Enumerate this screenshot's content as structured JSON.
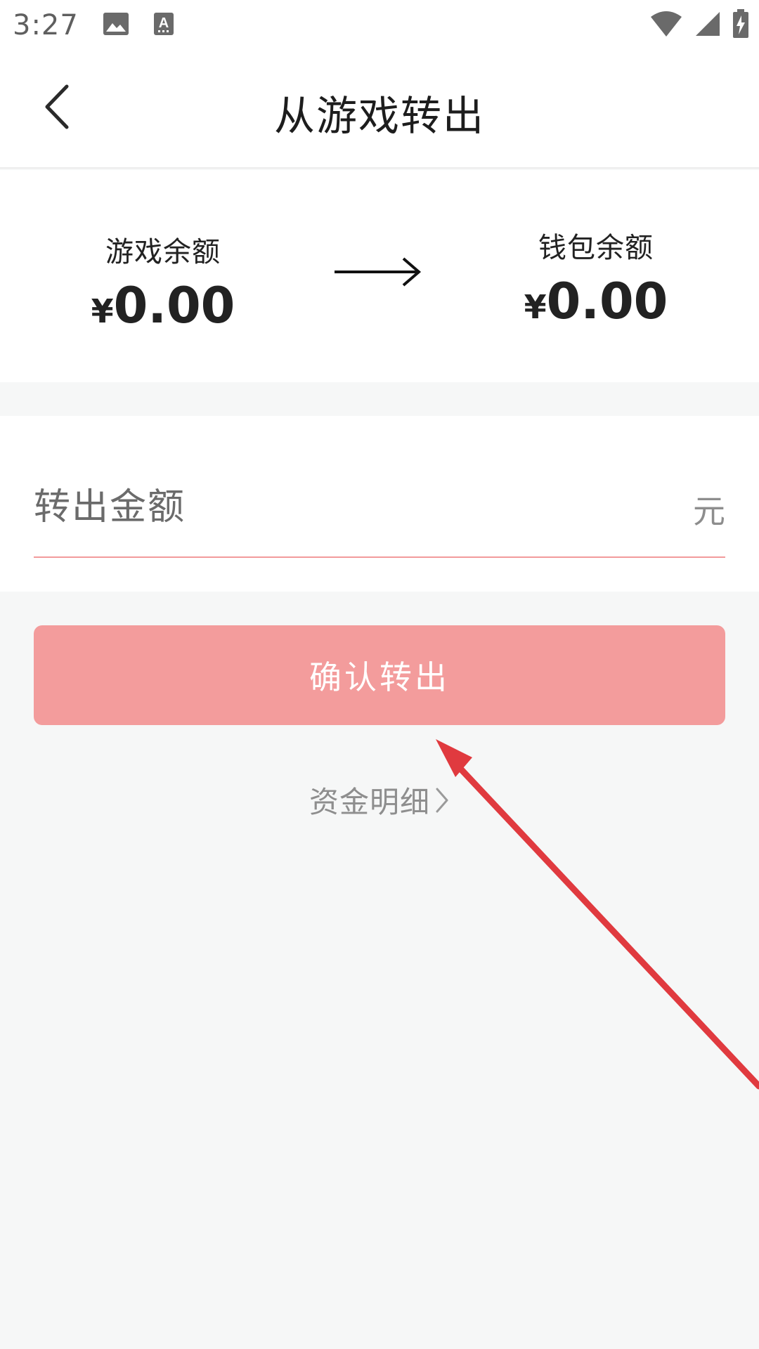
{
  "status_bar": {
    "time": "3:27",
    "icons": [
      "image-icon",
      "text-a-icon",
      "wifi-icon",
      "signal-icon",
      "battery-charging-icon"
    ]
  },
  "header": {
    "title": "从游戏转出"
  },
  "balances": {
    "game": {
      "label": "游戏余额",
      "currency": "¥",
      "amount": "0.00"
    },
    "wallet": {
      "label": "钱包余额",
      "currency": "¥",
      "amount": "0.00"
    }
  },
  "transfer_form": {
    "amount_placeholder": "转出金额",
    "amount_value": "",
    "unit": "元",
    "confirm_label": "确认转出"
  },
  "links": {
    "details_label": "资金明细"
  },
  "colors": {
    "accent": "#f39c9c",
    "annotation": "#e03a3f",
    "background": "#f6f7f7"
  }
}
